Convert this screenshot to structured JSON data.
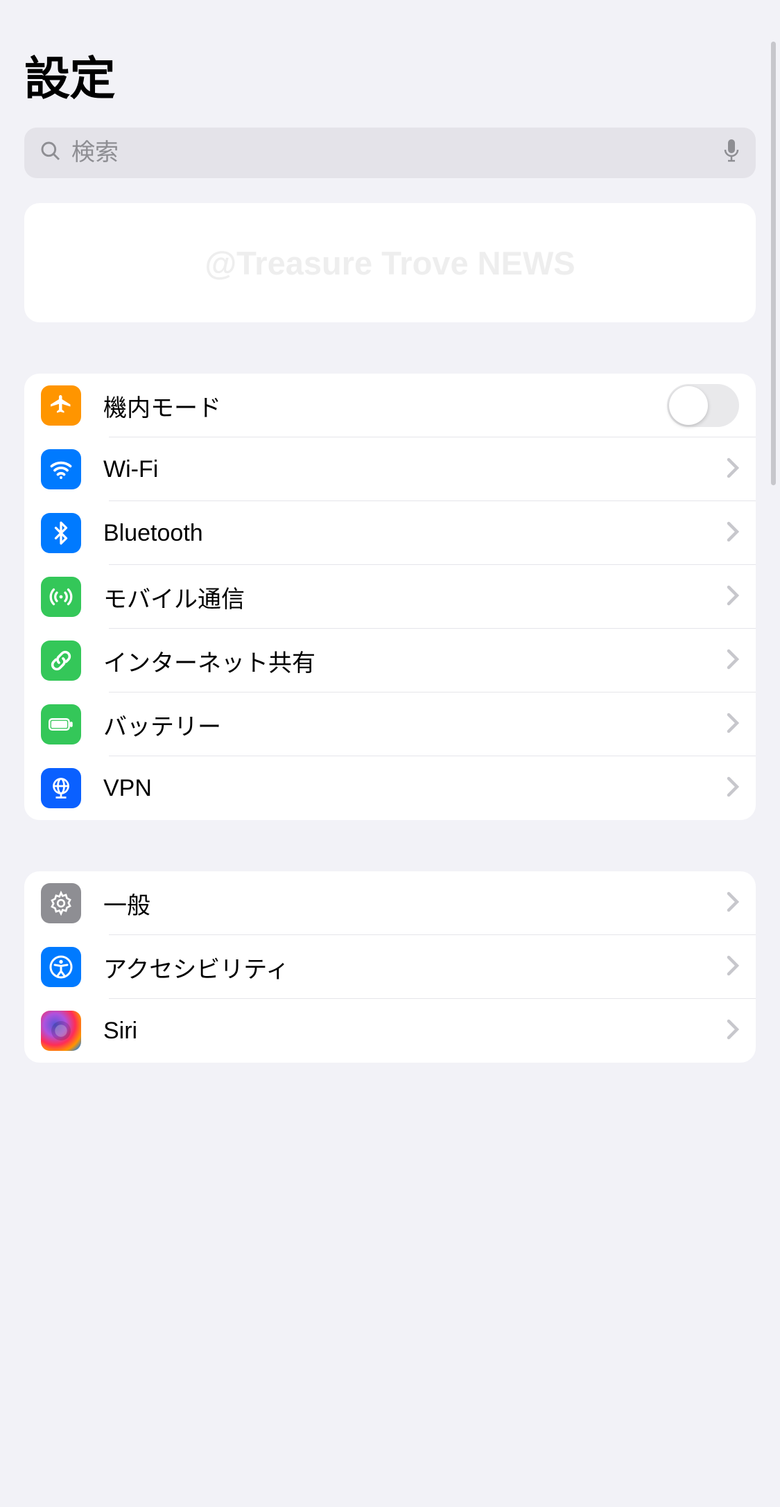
{
  "page_title": "設定",
  "search": {
    "placeholder": "検索"
  },
  "watermark": "@Treasure Trove NEWS",
  "group1": {
    "airplane": {
      "label": "機内モード",
      "toggle": false
    },
    "wifi": {
      "label": "Wi-Fi"
    },
    "bluetooth": {
      "label": "Bluetooth"
    },
    "cellular": {
      "label": "モバイル通信"
    },
    "hotspot": {
      "label": "インターネット共有"
    },
    "battery": {
      "label": "バッテリー"
    },
    "vpn": {
      "label": "VPN"
    }
  },
  "group2": {
    "general": {
      "label": "一般"
    },
    "accessibility": {
      "label": "アクセシビリティ"
    },
    "siri": {
      "label": "Siri"
    }
  }
}
